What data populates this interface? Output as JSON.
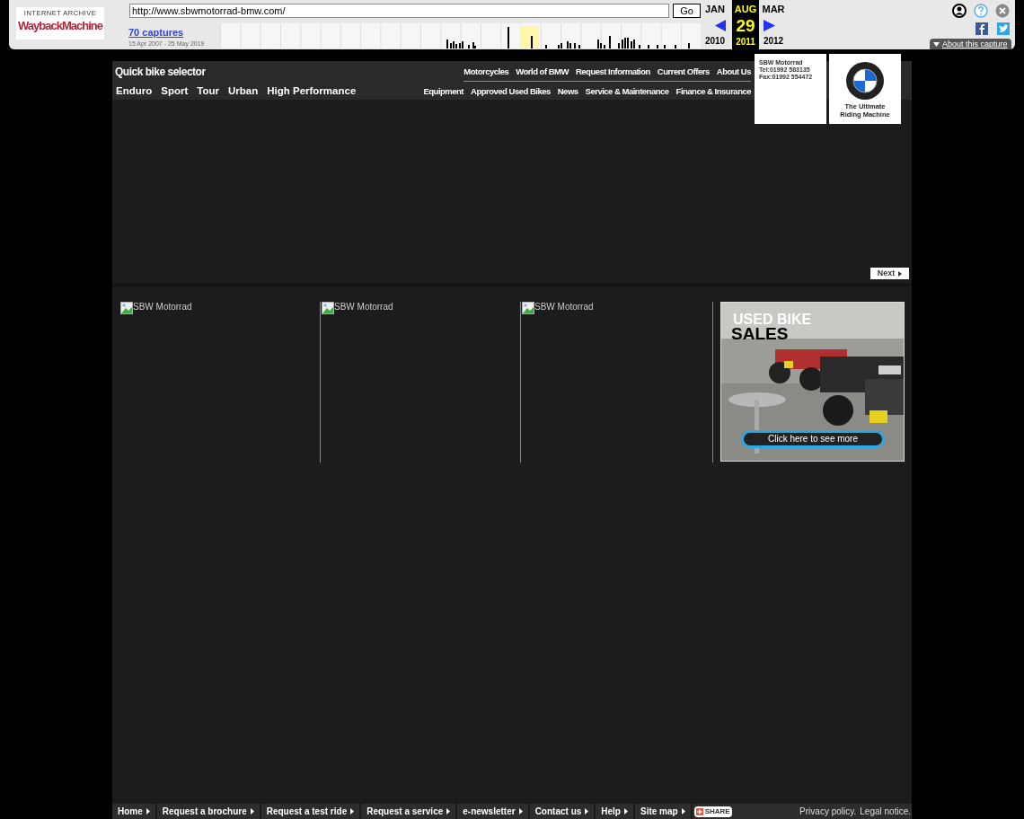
{
  "wayback": {
    "logo_top": "INTERNET ARCHIVE",
    "logo_main": "WaybackMachine",
    "url": "http://www.sbwmotorrad-bmw.com/",
    "go": "Go",
    "captures": "70 captures",
    "range": "15 Apr 2007 - 25 May 2019",
    "months": [
      {
        "month": "JAN",
        "year": "2010",
        "selected": false
      },
      {
        "month": "AUG",
        "day": "29",
        "year": "2011",
        "selected": true
      },
      {
        "month": "MAR",
        "year": "2012",
        "selected": false
      }
    ],
    "about": "About this capture"
  },
  "nav": {
    "title": "Quick bike selector",
    "categories": [
      "Enduro",
      "Sport",
      "Tour",
      "Urban",
      "High Performance"
    ],
    "top_links": [
      "Motorcycles",
      "World of BMW",
      "Request Information",
      "Current Offers",
      "About Us"
    ],
    "bottom_links": [
      "Equipment",
      "Approved Used Bikes",
      "News",
      "Service & Maintenance",
      "Finance & Insurance"
    ]
  },
  "contact": {
    "name": "SBW Motorrad",
    "tel": "Tel:01992 583135",
    "fax": "Fax:01992 554472"
  },
  "brand": {
    "tagline_1": "The Ultimate",
    "tagline_2": "Riding Machine"
  },
  "next": "Next",
  "tiles": [
    {
      "alt": "SBW Motorrad"
    },
    {
      "alt": "SBW Motorrad"
    },
    {
      "alt": "SBW Motorrad"
    }
  ],
  "ad": {
    "kind": "picture",
    "line_1": "USED BIKE",
    "line_2": "SALES",
    "button": "Click here to see more"
  },
  "footer": {
    "links": [
      "Home",
      "Request a brochure",
      "Request a test ride",
      "Request a service",
      "e-newsletter",
      "Contact us",
      "Help",
      "Site map"
    ],
    "share": "SHARE",
    "legal": [
      "Privacy policy.",
      "Legal notice."
    ]
  }
}
